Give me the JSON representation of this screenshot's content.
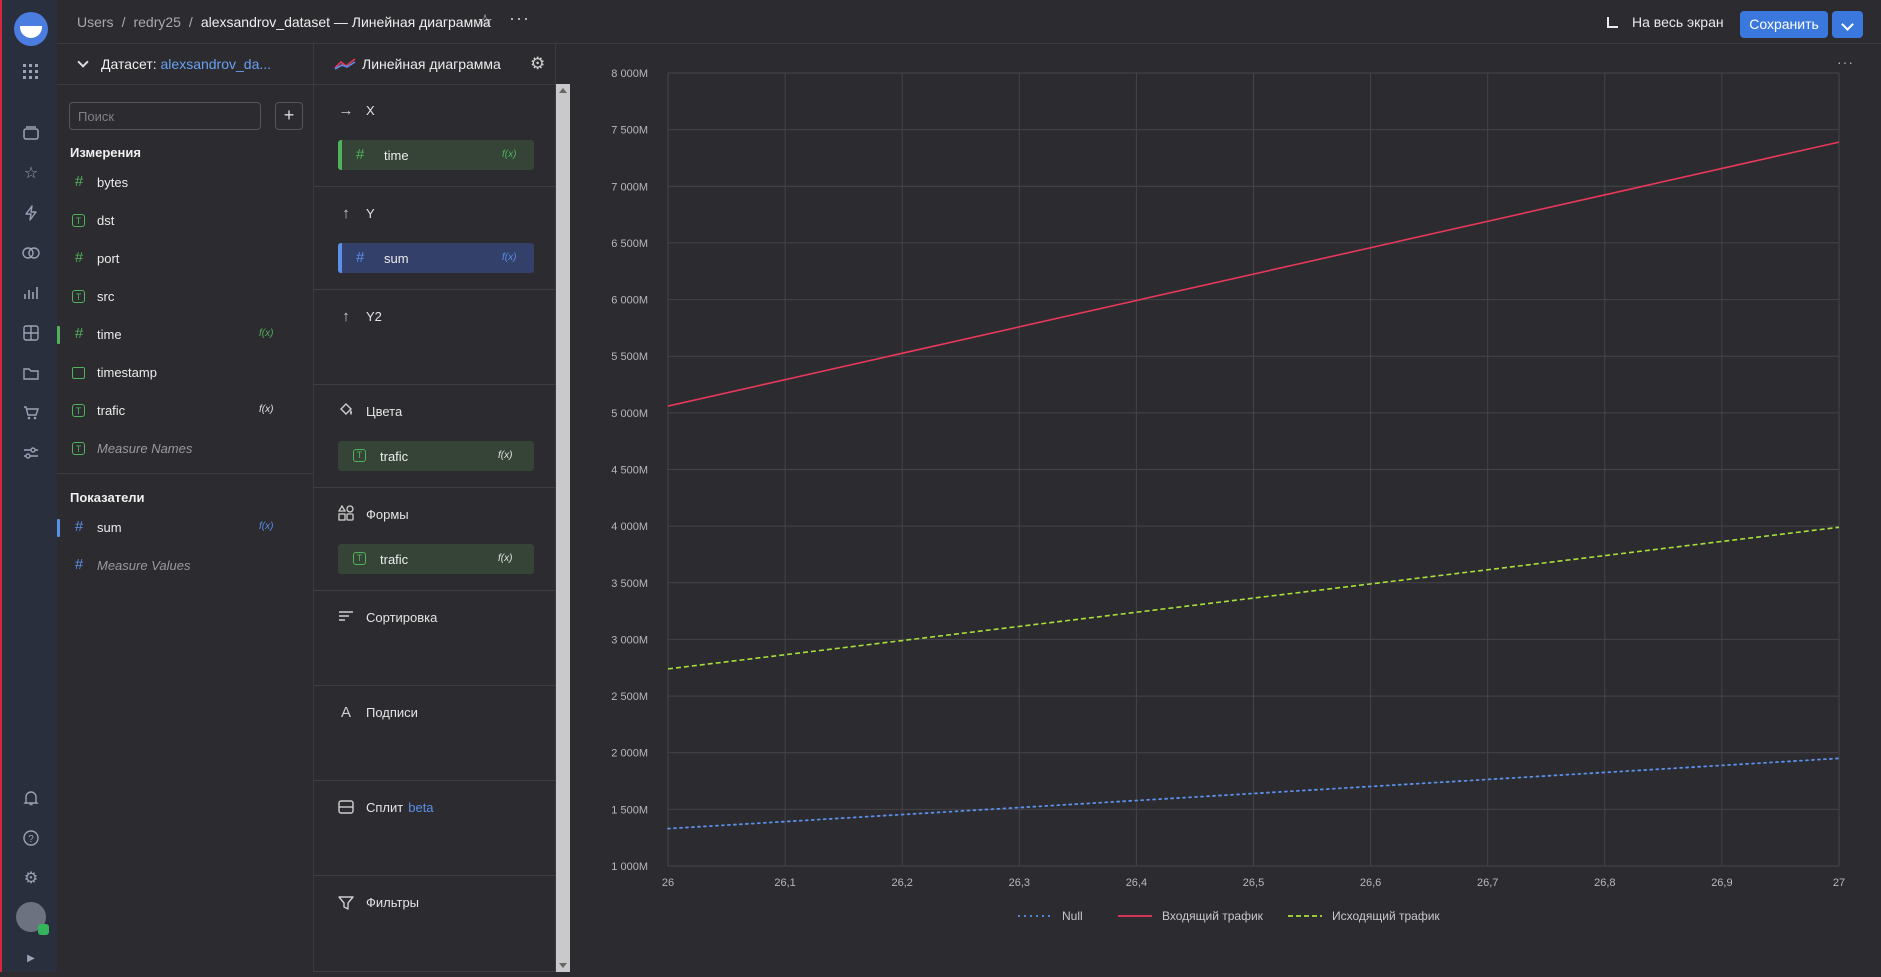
{
  "breadcrumbs": {
    "root": "Users",
    "folder": "redry25",
    "current": "alexsandrov_dataset — Линейная диаграмма"
  },
  "topbar": {
    "fullscreen_label": "На весь экран",
    "save_label": "Сохранить"
  },
  "dataset": {
    "label": "Датасет:",
    "name": "alexsandrov_da...",
    "search_placeholder": "Поиск",
    "dimensions_title": "Измерения",
    "dimensions": [
      {
        "name": "bytes",
        "type": "number",
        "formula": false
      },
      {
        "name": "dst",
        "type": "string",
        "formula": false
      },
      {
        "name": "port",
        "type": "number",
        "formula": false
      },
      {
        "name": "src",
        "type": "string",
        "formula": false
      },
      {
        "name": "time",
        "type": "number",
        "formula": true,
        "selected": true
      },
      {
        "name": "timestamp",
        "type": "date",
        "formula": false
      },
      {
        "name": "trafic",
        "type": "string",
        "formula": true
      },
      {
        "name": "Measure Names",
        "type": "string",
        "formula": false,
        "italic": true
      }
    ],
    "measures_title": "Показатели",
    "measures": [
      {
        "name": "sum",
        "type": "number",
        "formula": true,
        "selected": true
      },
      {
        "name": "Measure Values",
        "type": "number",
        "formula": false,
        "italic": true
      }
    ],
    "formula_mark": "f(x)"
  },
  "viz": {
    "title": "Линейная диаграмма",
    "x_title": "X",
    "x_field": "time",
    "y_title": "Y",
    "y_field": "sum",
    "y2_title": "Y2",
    "colors_title": "Цвета",
    "colors_field": "trafic",
    "shapes_title": "Формы",
    "shapes_field": "trafic",
    "sort_title": "Сортировка",
    "labels_title": "Подписи",
    "split_title": "Сплит",
    "split_badge": "beta",
    "filters_title": "Фильтры"
  },
  "chart_data": {
    "type": "line",
    "x": [
      26,
      27
    ],
    "xticks": [
      "26",
      "26,1",
      "26,2",
      "26,3",
      "26,4",
      "26,5",
      "26,6",
      "26,7",
      "26,8",
      "26,9",
      "27"
    ],
    "yticks": [
      "1 000M",
      "1 500M",
      "2 000M",
      "2 500M",
      "3 000M",
      "3 500M",
      "4 000M",
      "4 500M",
      "5 000M",
      "5 500M",
      "6 000M",
      "6 500M",
      "7 000M",
      "7 500M",
      "8 000M"
    ],
    "ylim": [
      1000,
      8000
    ],
    "xlim": [
      26,
      27
    ],
    "grid": true,
    "legend_position": "bottom",
    "series": [
      {
        "name": "Null",
        "values": [
          1330,
          1950
        ],
        "color": "#5b8fe8",
        "dash": "dotted"
      },
      {
        "name": "Входящий трафик",
        "values": [
          5060,
          7390
        ],
        "color": "#e8385a",
        "dash": "solid"
      },
      {
        "name": "Исходящий трафик",
        "values": [
          2740,
          3990
        ],
        "color": "#a8e03a",
        "dash": "dashed"
      }
    ]
  }
}
